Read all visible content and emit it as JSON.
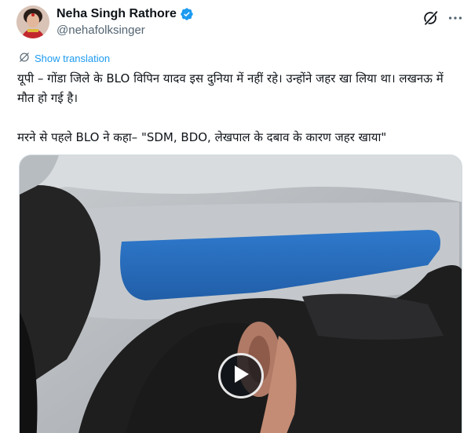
{
  "author": {
    "display_name": "Neha Singh Rathore",
    "handle": "@nehafolksinger",
    "verified": true
  },
  "actions": {
    "grok_icon": "grok-icon",
    "more_icon": "more-icon"
  },
  "translation": {
    "label": "Show translation",
    "icon": "globe-icon"
  },
  "tweet": {
    "line1": "यूपी – गोंडा जिले के BLO विपिन यादव इस दुनिया में नहीं रहे। उन्होंने जहर खा लिया था। लखनऊ में मौत हो गई है।",
    "line2": "मरने से पहले BLO ने कहा– \"SDM, BDO, लेखपाल के दबाव के कारण जहर खाया\""
  },
  "media": {
    "type": "video",
    "play_icon": "play-icon"
  },
  "colors": {
    "accent": "#1d9bf0",
    "text": "#0f1419",
    "muted": "#536471"
  }
}
